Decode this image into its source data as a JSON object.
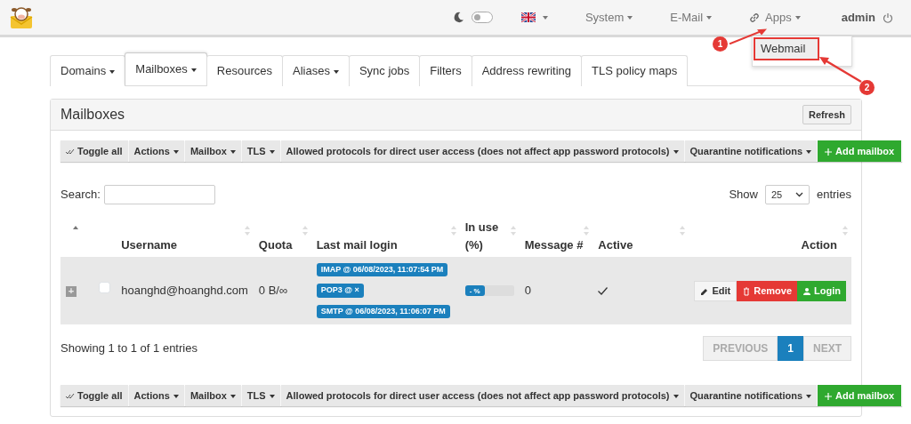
{
  "navbar": {
    "dark_mode": {
      "on": false
    },
    "language": {
      "kind": "flag"
    },
    "menus": [
      {
        "label": "System",
        "kind": "plain"
      },
      {
        "label": "E-Mail",
        "kind": "plain"
      },
      {
        "label": "Apps",
        "kind": "link"
      }
    ],
    "user": "admin"
  },
  "apps_menu": {
    "items": [
      {
        "label": "Webmail",
        "highlighted": true
      }
    ]
  },
  "annotations": [
    {
      "label": "1"
    },
    {
      "label": "2"
    }
  ],
  "tabs": [
    {
      "label": "Domains",
      "dropdown": true,
      "selected": false
    },
    {
      "label": "Mailboxes",
      "dropdown": true,
      "selected": true
    },
    {
      "label": "Resources",
      "dropdown": false,
      "selected": false
    },
    {
      "label": "Aliases",
      "dropdown": true,
      "selected": false
    },
    {
      "label": "Sync jobs",
      "dropdown": false,
      "selected": false
    },
    {
      "label": "Filters",
      "dropdown": false,
      "selected": false
    },
    {
      "label": "Address rewriting",
      "dropdown": false,
      "selected": false
    },
    {
      "label": "TLS policy maps",
      "dropdown": false,
      "selected": false
    }
  ],
  "panel": {
    "title": "Mailboxes",
    "refresh": "Refresh"
  },
  "toolbar_top": [
    {
      "label": "Toggle all",
      "kind": "toggle"
    },
    {
      "label": "Actions",
      "kind": "dropdown"
    },
    {
      "label": "Mailbox",
      "kind": "dropdown"
    },
    {
      "label": "TLS",
      "kind": "dropdown"
    },
    {
      "label": "Allowed protocols for direct user access (does not affect app password protocols)",
      "kind": "dropdown"
    },
    {
      "label": "Quarantine notifications",
      "kind": "dropdown"
    },
    {
      "label": "Add mailbox",
      "kind": "add"
    }
  ],
  "search": {
    "label": "Search:"
  },
  "page_size": {
    "label": "Show",
    "value": "25",
    "suffix": "entries"
  },
  "table": {
    "columns": [
      {
        "sortable": true,
        "sorted": true
      },
      {
        "sortable": false
      },
      {
        "label": "Username",
        "sortable": true,
        "sorted": false
      },
      {
        "label": "Quota",
        "sortable": true,
        "sorted": false
      },
      {
        "label": "Last mail login",
        "sortable": true,
        "sorted": false
      },
      {
        "label": "In use (%)",
        "sortable": true,
        "sorted": false
      },
      {
        "label": "Message #",
        "sortable": true,
        "sorted": false
      },
      {
        "label": "Active",
        "sortable": true,
        "sorted": false
      },
      {
        "label": "Action",
        "sortable": true,
        "sorted": false
      }
    ],
    "rows": [
      {
        "expand": "+",
        "checked": false,
        "username": "hoanghd@hoanghd.com",
        "quota": "0 B/∞",
        "logins": [
          "IMAP @ 06/08/2023, 11:07:54 PM",
          "POP3 @ ×",
          "SMTP @ 06/08/2023, 11:06:07 PM"
        ],
        "in_use": "- %",
        "messages": "0",
        "active": true,
        "actions": [
          {
            "label": "Edit",
            "kind": "edit"
          },
          {
            "label": "Remove",
            "kind": "remove"
          },
          {
            "label": "Login",
            "kind": "login"
          }
        ]
      }
    ]
  },
  "info": "Showing 1 to 1 of 1 entries",
  "pagination": [
    {
      "label": "PREVIOUS",
      "disabled": true,
      "selected": false
    },
    {
      "label": "1",
      "disabled": false,
      "selected": true
    },
    {
      "label": "NEXT",
      "disabled": true,
      "selected": false
    }
  ],
  "toolbar_bottom": [
    {
      "label": "Toggle all",
      "kind": "toggle"
    },
    {
      "label": "Actions",
      "kind": "dropdown"
    },
    {
      "label": "Mailbox",
      "kind": "dropdown"
    },
    {
      "label": "TLS",
      "kind": "dropdown"
    },
    {
      "label": "Allowed protocols for direct user access (does not affect app password protocols)",
      "kind": "dropdown"
    },
    {
      "label": "Quarantine notifications",
      "kind": "dropdown"
    },
    {
      "label": "Add mailbox",
      "kind": "add"
    }
  ]
}
